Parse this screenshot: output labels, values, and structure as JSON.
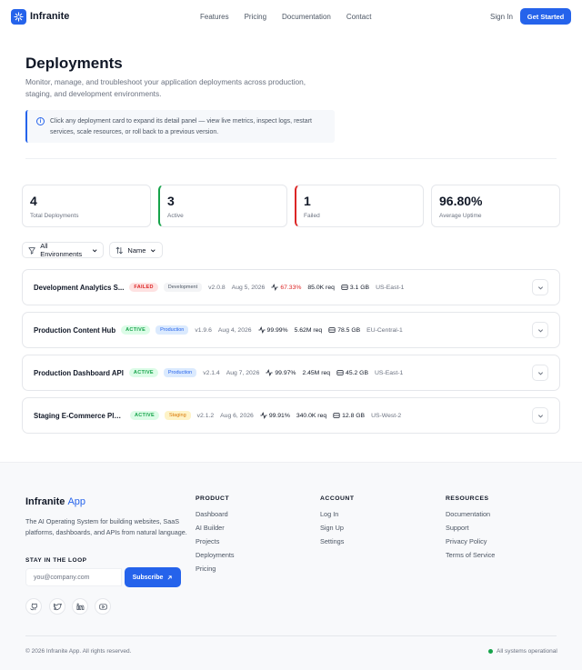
{
  "nav": {
    "brand": "Infranite",
    "links": [
      "Features",
      "Pricing",
      "Documentation",
      "Contact"
    ],
    "signin": "Sign In",
    "cta": "Get Started"
  },
  "page": {
    "title": "Deployments",
    "subtitle": "Monitor, manage, and troubleshoot your application deployments across production, staging, and development environments.",
    "info": "Click any deployment card to expand its detail panel — view live metrics, inspect logs, restart services, scale resources, or roll back to a previous version."
  },
  "stats": [
    {
      "value": "4",
      "label": "Total Deployments"
    },
    {
      "value": "3",
      "label": "Active"
    },
    {
      "value": "1",
      "label": "Failed"
    },
    {
      "value": "96.80%",
      "label": "Average Uptime"
    }
  ],
  "filters": {
    "environment": "All Environments",
    "sort": "Name"
  },
  "deployments": [
    {
      "name": "Development Analytics S...",
      "status": "FAILED",
      "env": "Development",
      "version": "v2.0.8",
      "date": "Aug 5, 2026",
      "uptime": "67.33%",
      "requests": "85.0K req",
      "storage": "3.1 GB",
      "region": "US-East-1"
    },
    {
      "name": "Production Content Hub",
      "status": "ACTIVE",
      "env": "Production",
      "version": "v1.9.6",
      "date": "Aug 4, 2026",
      "uptime": "99.99%",
      "requests": "5.62M req",
      "storage": "78.5 GB",
      "region": "EU-Central-1"
    },
    {
      "name": "Production Dashboard API",
      "status": "ACTIVE",
      "env": "Production",
      "version": "v2.1.4",
      "date": "Aug 7, 2026",
      "uptime": "99.97%",
      "requests": "2.45M req",
      "storage": "45.2 GB",
      "region": "US-East-1"
    },
    {
      "name": "Staging E-Commerce Plat...",
      "status": "ACTIVE",
      "env": "Staging",
      "version": "v2.1.2",
      "date": "Aug 6, 2026",
      "uptime": "99.91%",
      "requests": "340.0K req",
      "storage": "12.8 GB",
      "region": "US-West-2"
    }
  ],
  "footer": {
    "brand_a": "Infranite",
    "brand_b": "App",
    "desc": "The AI Operating System for building websites, SaaS platforms, dashboards, and APIs from natural language.",
    "newsletter_label": "STAY IN THE LOOP",
    "email_placeholder": "you@company.com",
    "subscribe": "Subscribe",
    "columns": [
      {
        "head": "PRODUCT",
        "items": [
          "Dashboard",
          "AI Builder",
          "Projects",
          "Deployments",
          "Pricing"
        ]
      },
      {
        "head": "ACCOUNT",
        "items": [
          "Log In",
          "Sign Up",
          "Settings"
        ]
      },
      {
        "head": "RESOURCES",
        "items": [
          "Documentation",
          "Support",
          "Privacy Policy",
          "Terms of Service"
        ]
      }
    ],
    "copyright": "© 2026 Infranite App. All rights reserved.",
    "status": "All systems operational"
  },
  "colors": {
    "accent": "#2563eb",
    "success": "#16a34a",
    "danger": "#dc2626"
  },
  "icons": [
    "logo-sparkle-icon",
    "info-icon",
    "filter-icon",
    "sort-icon",
    "chevron-down-icon",
    "activity-icon",
    "database-icon",
    "github-icon",
    "twitter-icon",
    "linkedin-icon",
    "youtube-icon",
    "arrow-up-right-icon"
  ]
}
